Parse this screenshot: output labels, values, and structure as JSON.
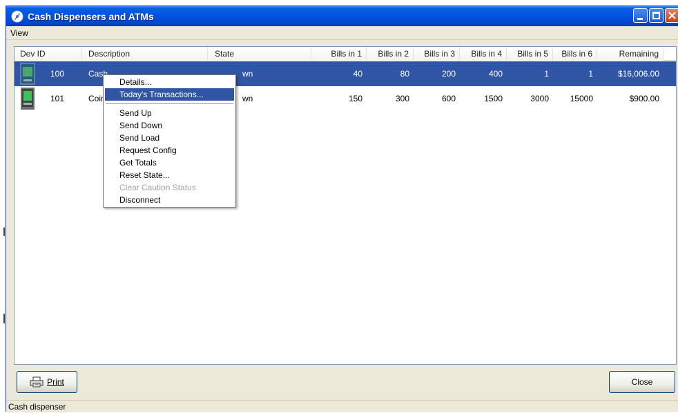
{
  "window": {
    "title": "Cash Dispensers and ATMs"
  },
  "menubar": {
    "view_label": "View"
  },
  "columns": [
    "Dev ID",
    "Description",
    "State",
    "Bills in 1",
    "Bills in 2",
    "Bills in 3",
    "Bills in 4",
    "Bills in 5",
    "Bills in 6",
    "Remaining"
  ],
  "rows": [
    {
      "dev_id": "100",
      "description": "Cash",
      "state": "wn",
      "bills_in_1": "40",
      "bills_in_2": "80",
      "bills_in_3": "200",
      "bills_in_4": "400",
      "bills_in_5": "1",
      "bills_in_6": "1",
      "remaining": "$16,006.00",
      "selected": true
    },
    {
      "dev_id": "101",
      "description": "Coin",
      "state": "wn",
      "bills_in_1": "150",
      "bills_in_2": "300",
      "bills_in_3": "600",
      "bills_in_4": "1500",
      "bills_in_5": "3000",
      "bills_in_6": "15000",
      "remaining": "$900.00",
      "selected": false
    }
  ],
  "context_menu": {
    "items": [
      {
        "label": "Details..."
      },
      {
        "label": "Today's Transactions...",
        "highlighted": true
      },
      {
        "label": "Send Up"
      },
      {
        "label": "Send Down"
      },
      {
        "label": "Send Load"
      },
      {
        "label": "Request Config"
      },
      {
        "label": "Get Totals"
      },
      {
        "label": "Reset State..."
      },
      {
        "label": "Clear Caution Status",
        "disabled": true
      },
      {
        "label": "Disconnect"
      }
    ]
  },
  "buttons": {
    "print_label": "Print",
    "close_label": "Close"
  },
  "statusbar": {
    "text": "Cash dispenser"
  },
  "colors": {
    "title_bar": "#0054e3",
    "selection": "#2f55a4",
    "window_bg": "#ece9d8"
  }
}
